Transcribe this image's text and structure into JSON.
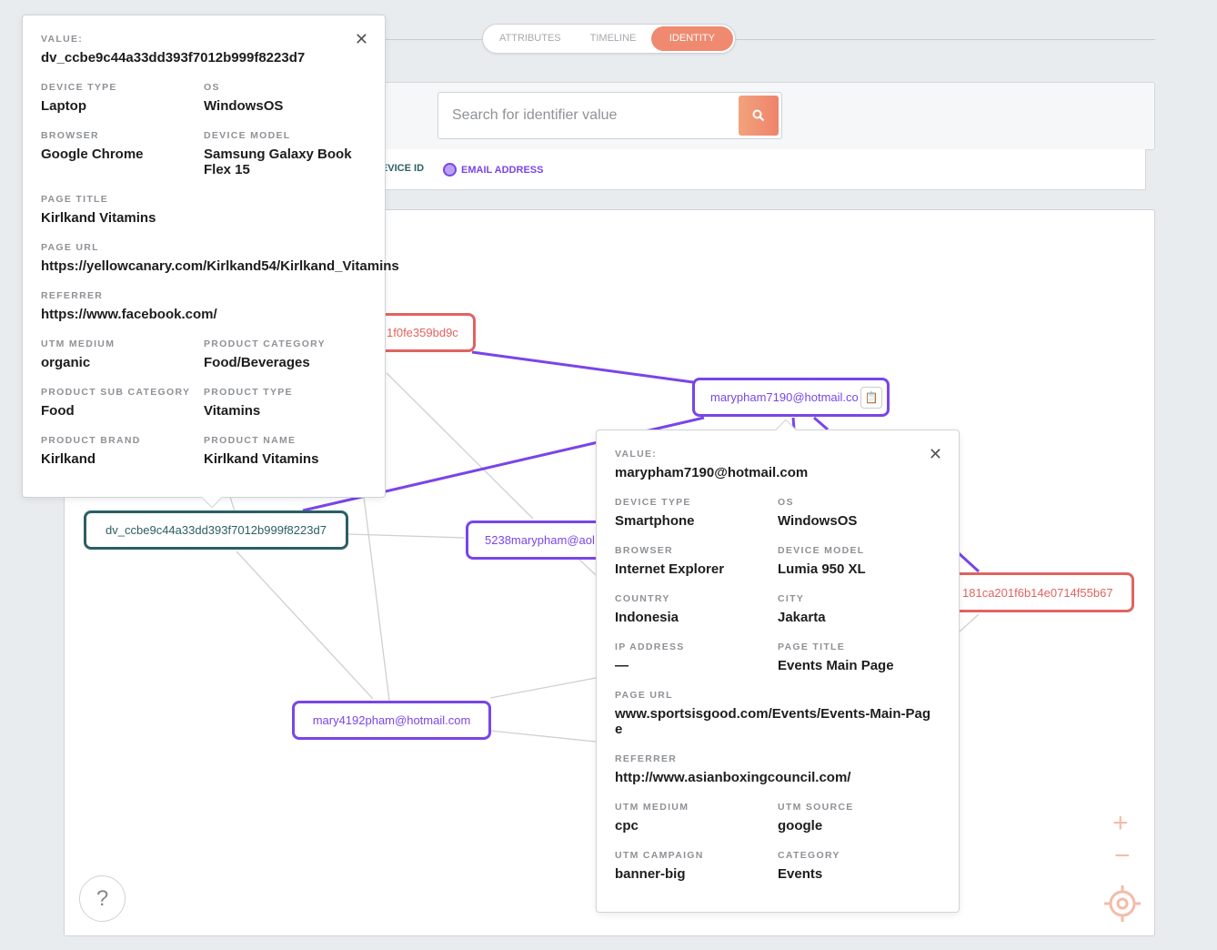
{
  "tabs": [
    {
      "label": "ATTRIBUTES",
      "active": false
    },
    {
      "label": "TIMELINE",
      "active": false
    },
    {
      "label": "IDENTITY",
      "active": true
    }
  ],
  "search": {
    "placeholder": "Search for identifier value",
    "value": "",
    "icon": "search-icon"
  },
  "legend": [
    {
      "label": "DEVICE ID",
      "color": "#2b5f63"
    },
    {
      "label": "EMAIL ADDRESS",
      "color": "#7a45e8"
    }
  ],
  "colors": {
    "accent": "#ef8a70",
    "email": "#7a45e8",
    "device": "#e06460",
    "device_id": "#2b5f63"
  },
  "graph": {
    "nodes": [
      {
        "label": "1f0fe359bd9c",
        "type": "device"
      },
      {
        "label": "marypham7190@hotmail.co",
        "type": "email"
      },
      {
        "label": "dv_ccbe9c44a33dd393f7012b999f8223d7",
        "type": "device_id"
      },
      {
        "label": "5238marypham@aol",
        "type": "email"
      },
      {
        "label": "181ca201f6b14e0714f55b67",
        "type": "device"
      },
      {
        "label": "mary4192pham@hotmail.com",
        "type": "email"
      }
    ]
  },
  "popover_device": {
    "value_label": "VALUE:",
    "value": "dv_ccbe9c44a33dd393f7012b999f8223d7",
    "fields": [
      {
        "label": "DEVICE TYPE",
        "value": "Laptop"
      },
      {
        "label": "OS",
        "value": "WindowsOS"
      },
      {
        "label": "BROWSER",
        "value": "Google Chrome"
      },
      {
        "label": "DEVICE MODEL",
        "value": "Samsung Galaxy Book Flex 15"
      },
      {
        "label": "PAGE TITLE",
        "value": "Kirlkand Vitamins"
      },
      {
        "label": "PAGE URL",
        "value": "https://yellowcanary.com/Kirlkand54/Kirlkand_Vitamins"
      },
      {
        "label": "REFERRER",
        "value": "https://www.facebook.com/"
      },
      {
        "label": "UTM MEDIUM",
        "value": "organic"
      },
      {
        "label": "PRODUCT CATEGORY",
        "value": "Food/Beverages"
      },
      {
        "label": "PRODUCT SUB CATEGORY",
        "value": "Food"
      },
      {
        "label": "PRODUCT TYPE",
        "value": "Vitamins"
      },
      {
        "label": "PRODUCT BRAND",
        "value": "Kirlkand"
      },
      {
        "label": "PRODUCT NAME",
        "value": "Kirlkand Vitamins"
      }
    ]
  },
  "popover_email": {
    "value_label": "VALUE:",
    "value": "marypham7190@hotmail.com",
    "fields": [
      {
        "label": "DEVICE TYPE",
        "value": "Smartphone"
      },
      {
        "label": "OS",
        "value": "WindowsOS"
      },
      {
        "label": "BROWSER",
        "value": "Internet Explorer"
      },
      {
        "label": "DEVICE MODEL",
        "value": "Lumia 950 XL"
      },
      {
        "label": "COUNTRY",
        "value": "Indonesia"
      },
      {
        "label": "CITY",
        "value": "Jakarta"
      },
      {
        "label": "IP ADDRESS",
        "value": "—"
      },
      {
        "label": "PAGE TITLE",
        "value": "Events Main Page"
      },
      {
        "label": "PAGE URL",
        "value": "www.sportsisgood.com/Events/Events-Main-Page"
      },
      {
        "label": "REFERRER",
        "value": "http://www.asianboxingcouncil.com/"
      },
      {
        "label": "UTM MEDIUM",
        "value": "cpc"
      },
      {
        "label": "UTM SOURCE",
        "value": "google"
      },
      {
        "label": "UTM CAMPAIGN",
        "value": "banner-big"
      },
      {
        "label": "CATEGORY",
        "value": "Events"
      }
    ]
  }
}
